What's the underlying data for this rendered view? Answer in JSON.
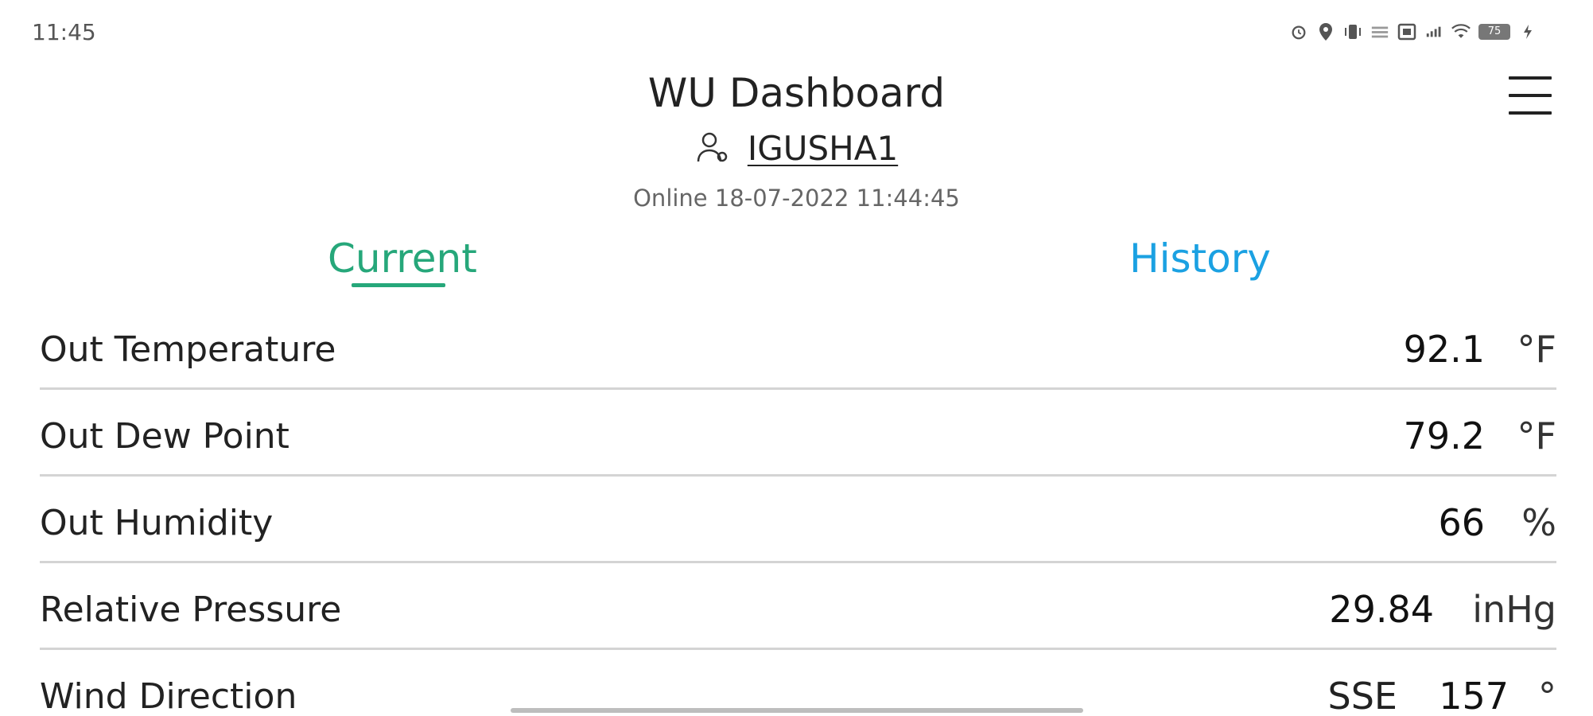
{
  "status_bar": {
    "time": "11:45",
    "battery": "75",
    "icons": [
      "alarm-icon",
      "location-icon",
      "vibrate-icon",
      "data-speed-icon",
      "nfc-icon",
      "signal-icon",
      "wifi-icon",
      "battery-icon",
      "charging-icon"
    ]
  },
  "header": {
    "title": "WU Dashboard",
    "station_id": "IGUSHA1",
    "status": "Online 18-07-2022 11:44:45",
    "menu_icon": "hamburger-menu-icon"
  },
  "tabs": {
    "current": "Current",
    "history": "History",
    "active": "current",
    "colors": {
      "active": "#26a77a",
      "inactive": "#1ba1e2"
    }
  },
  "readings": [
    {
      "label": "Out Temperature",
      "value": "92.1",
      "unit": "°F"
    },
    {
      "label": "Out Dew Point",
      "value": "79.2",
      "unit": "°F"
    },
    {
      "label": "Out Humidity",
      "value": "66",
      "unit": "%"
    },
    {
      "label": "Relative Pressure",
      "value": "29.84",
      "unit": "inHg"
    },
    {
      "label": "Wind Direction",
      "direction": "SSE",
      "value": "157",
      "unit": "°"
    }
  ]
}
